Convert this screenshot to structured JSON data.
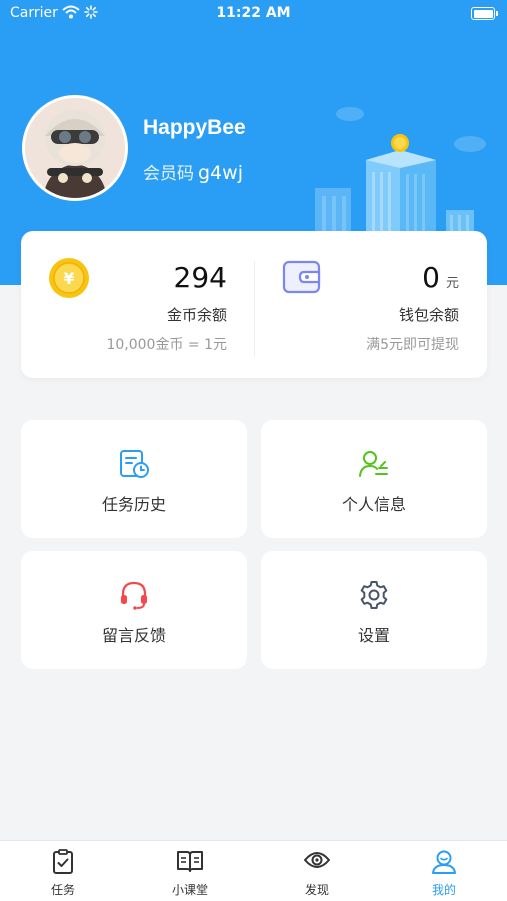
{
  "status_bar": {
    "carrier": "Carrier",
    "time": "11:22 AM"
  },
  "profile": {
    "username": "HappyBee",
    "member_label": "会员码",
    "member_code": "g4wj"
  },
  "balances": {
    "coins": {
      "value": "294",
      "label": "金币余额",
      "rate": "10,000金币 = 1元",
      "icon": "gold-coin-icon"
    },
    "wallet": {
      "value": "0",
      "unit": "元",
      "label": "钱包余额",
      "note": "满5元即可提现",
      "icon": "wallet-icon"
    }
  },
  "tiles": [
    {
      "label": "任务历史",
      "icon": "task-history-icon",
      "color": "#2a9df4"
    },
    {
      "label": "个人信息",
      "icon": "personal-info-icon",
      "color": "#52c41a"
    },
    {
      "label": "留言反馈",
      "icon": "headset-icon",
      "color": "#f5484a"
    },
    {
      "label": "设置",
      "icon": "gear-icon",
      "color": "#4a5468"
    }
  ],
  "tabs": [
    {
      "label": "任务",
      "icon": "clipboard-icon"
    },
    {
      "label": "小课堂",
      "icon": "book-icon"
    },
    {
      "label": "发现",
      "icon": "eye-icon"
    },
    {
      "label": "我的",
      "icon": "user-icon",
      "active": true
    }
  ],
  "colors": {
    "primary": "#2a9df4",
    "background": "#f3f4f6",
    "coin": "#f8c40f"
  }
}
